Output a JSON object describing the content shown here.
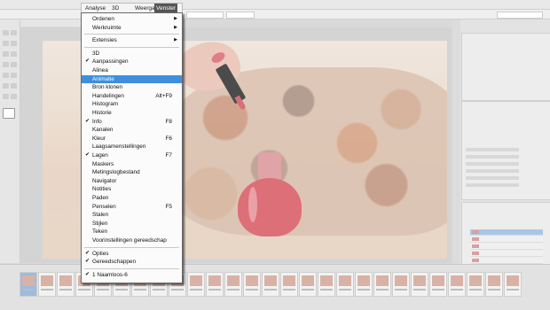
{
  "menubar": {
    "items": [
      {
        "label": "Analyse",
        "active": false
      },
      {
        "label": "3D",
        "active": false
      },
      {
        "label": "Weergave",
        "active": false
      },
      {
        "label": "Venster",
        "active": true
      }
    ]
  },
  "venster_menu": {
    "groups": [
      [
        {
          "label": "Ordenen",
          "submenu": true
        },
        {
          "label": "Werkruimte",
          "submenu": true
        }
      ],
      [
        {
          "label": "Extensies",
          "submenu": true
        }
      ],
      [
        {
          "label": "3D"
        },
        {
          "label": "Aanpassingen",
          "checked": true
        },
        {
          "label": "Alinea"
        },
        {
          "label": "Animatie",
          "highlighted": true
        },
        {
          "label": "Bron klonen"
        },
        {
          "label": "Handelingen",
          "shortcut": "Alt+F9"
        },
        {
          "label": "Histogram"
        },
        {
          "label": "Historie"
        },
        {
          "label": "Info",
          "checked": true,
          "shortcut": "F8"
        },
        {
          "label": "Kanalen"
        },
        {
          "label": "Kleur",
          "shortcut": "F6"
        },
        {
          "label": "Laagsamenstellingen"
        },
        {
          "label": "Lagen",
          "checked": true,
          "shortcut": "F7"
        },
        {
          "label": "Maskers"
        },
        {
          "label": "Metingslogbestand"
        },
        {
          "label": "Navigator"
        },
        {
          "label": "Notities"
        },
        {
          "label": "Paden"
        },
        {
          "label": "Penselen",
          "shortcut": "F5"
        },
        {
          "label": "Stalen"
        },
        {
          "label": "Stijlen"
        },
        {
          "label": "Teken"
        },
        {
          "label": "Voorinstellingen gereedschap"
        }
      ],
      [
        {
          "label": "Opties",
          "checked": true
        },
        {
          "label": "Gereedschappen",
          "checked": true
        }
      ],
      [
        {
          "label": "1 Naamloos-6",
          "checked": true
        }
      ]
    ]
  },
  "icons": {
    "check": "check-icon",
    "submenu": "chevron-right-icon"
  },
  "colors": {
    "menu_highlight": "#3f8fde",
    "menubar_active": "#555555"
  }
}
